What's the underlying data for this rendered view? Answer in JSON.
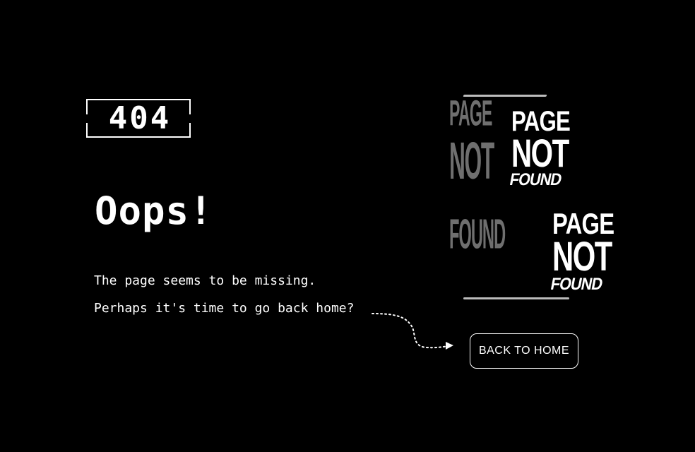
{
  "error_code": "404",
  "heading": "Oops!",
  "message": {
    "line1": "The page seems to be missing.",
    "line2": "Perhaps it's time to go back home?"
  },
  "graphic": {
    "ghost_lines": [
      "PAGE",
      "NOT",
      "FOUND"
    ],
    "stack_top_lines": [
      "PAGE",
      "NOT",
      "FOUND"
    ],
    "stack_bottom_lines": [
      "PAGE",
      "NOT",
      "FOUND"
    ]
  },
  "button": {
    "label": "BACK TO HOME"
  },
  "colors": {
    "background": "#000000",
    "foreground": "#ffffff",
    "ghost_text": "#6f6f6f"
  },
  "icons": {
    "arrow": "dotted-curved-arrow-icon"
  }
}
